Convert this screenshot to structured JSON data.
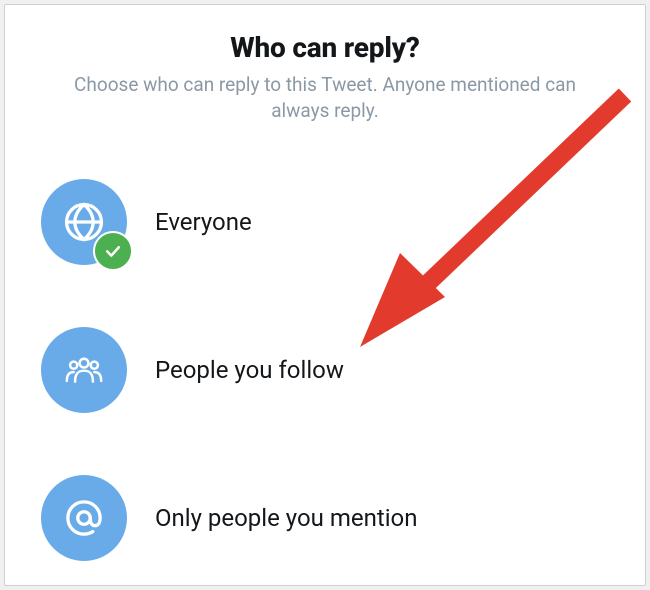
{
  "dialog": {
    "title": "Who can reply?",
    "subtitle": "Choose who can reply to this Tweet. Anyone mentioned can always reply."
  },
  "options": [
    {
      "label": "Everyone",
      "icon": "globe-icon",
      "selected": true
    },
    {
      "label": "People you follow",
      "icon": "people-icon",
      "selected": false
    },
    {
      "label": "Only people you mention",
      "icon": "at-icon",
      "selected": false
    }
  ],
  "colors": {
    "accent": "#68abe8",
    "success": "#4caf50",
    "text": "#14171a",
    "muted": "#8b98a5",
    "annotation": "#e23b2e"
  }
}
